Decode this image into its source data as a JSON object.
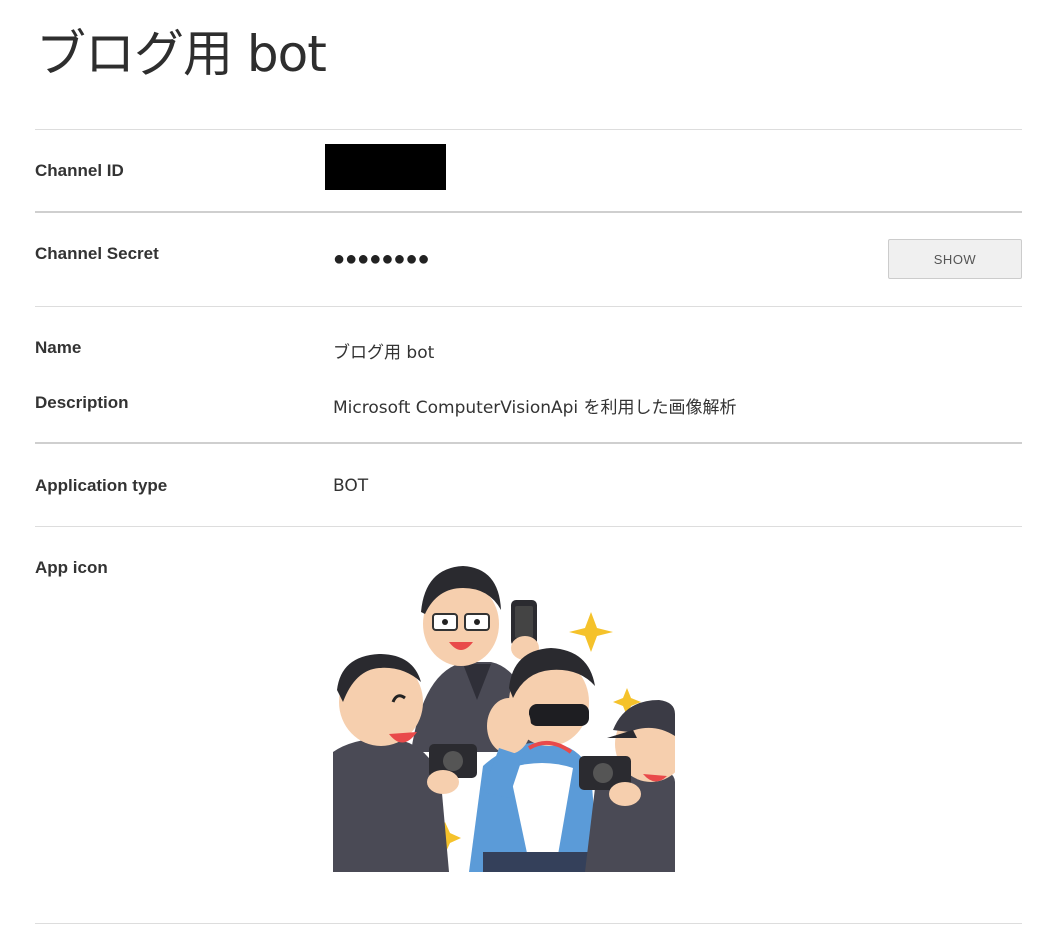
{
  "page": {
    "title": "ブログ用 bot"
  },
  "fields": {
    "channel_id": {
      "label": "Channel ID"
    },
    "channel_secret": {
      "label": "Channel Secret",
      "masked_value": "●●●●●●●●",
      "show_button": "SHOW"
    },
    "name": {
      "label": "Name",
      "value": "ブログ用 bot"
    },
    "description": {
      "label": "Description",
      "value": "Microsoft ComputerVisionApi を利用した画像解析"
    },
    "application_type": {
      "label": "Application type",
      "value": "BOT"
    },
    "app_icon": {
      "label": "App icon",
      "image": "paparazzi-illustration-icon"
    }
  },
  "colors": {
    "text": "#333333",
    "divider": "#dddddd",
    "button_bg": "#f0f0f0",
    "redaction": "#000000"
  }
}
